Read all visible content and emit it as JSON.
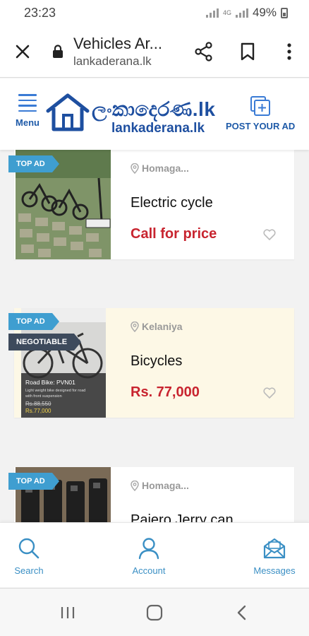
{
  "status_bar": {
    "time": "23:23",
    "network": "4G",
    "battery": "49%"
  },
  "browser": {
    "title": "Vehicles Ar...",
    "url": "lankaderana.lk"
  },
  "site": {
    "menu_label": "Menu",
    "logo_text": "ලංකාදෙරණ.lk",
    "logo_subtext": "lankaderana.lk",
    "post_ad_label": "POST YOUR AD"
  },
  "ads": [
    {
      "badges": [
        "TOP AD"
      ],
      "location": "Homaga...",
      "title": "Electric cycle",
      "price": "Call for price",
      "highlight": false
    },
    {
      "badges": [
        "TOP AD",
        "NEGOTIABLE"
      ],
      "location": "Kelaniya",
      "title": "Bicycles",
      "price": "Rs. 77,000",
      "highlight": true,
      "photo_text": {
        "line1": "Road Bike: PVN01",
        "line2": "Light weight bike designed for road",
        "line3": "with front suspension",
        "old_price": "Rs.88,550",
        "new_price": "Rs.77,000"
      }
    },
    {
      "badges": [
        "TOP AD"
      ],
      "location": "Homaga...",
      "title": "Pajero Jerry can",
      "price": "",
      "highlight": false
    }
  ],
  "bottom_nav": [
    {
      "label": "Search",
      "icon": "search-icon"
    },
    {
      "label": "Account",
      "icon": "account-icon"
    },
    {
      "label": "Messages",
      "icon": "envelope-icon"
    }
  ],
  "colors": {
    "brand_blue": "#1e4fa0",
    "price_red": "#c8242f",
    "badge_blue": "#3f9ed0",
    "badge_dark": "#3d4a5c",
    "nav_blue": "#3a8fc4",
    "highlight": "#fdf8e6"
  }
}
